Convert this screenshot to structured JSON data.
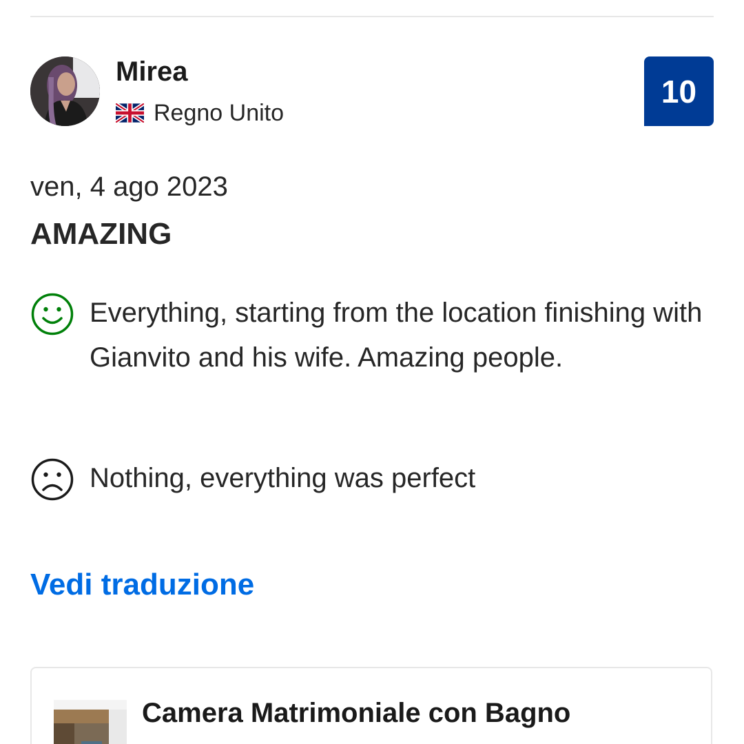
{
  "reviewer": {
    "name": "Mirea",
    "country": "Regno Unito"
  },
  "score": "10",
  "review": {
    "date": "ven, 4 ago 2023",
    "title": "AMAZING",
    "positive": "Everything, starting from the location finishing with Gianvito and his wife. Amazing people.",
    "negative": "Nothing, everything was perfect"
  },
  "translate_link": "Vedi traduzione",
  "room": {
    "name": "Camera Matrimoniale con Bagno"
  },
  "icons": {
    "positive": "smiley-face-icon",
    "negative": "sad-face-icon",
    "flag": "uk-flag-icon"
  },
  "colors": {
    "score_badge": "#003b95",
    "link": "#006ce4",
    "positive_icon": "#008009",
    "negative_icon": "#1a1a1a"
  }
}
